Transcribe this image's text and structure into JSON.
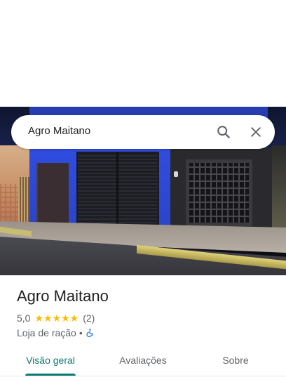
{
  "search": {
    "query": "Agro Maitano",
    "search_icon": "search-icon",
    "close_icon": "close-icon"
  },
  "place": {
    "name": "Agro Maitano",
    "rating": "5,0",
    "stars": "★★★★★",
    "star_count": 5,
    "review_count": "(2)",
    "category": "Loja de ração",
    "separator": "•",
    "accessibility_icon": "wheelchair-icon"
  },
  "tabs": [
    {
      "label": "Visão geral",
      "active": true
    },
    {
      "label": "Avaliações",
      "active": false
    },
    {
      "label": "Sobre",
      "active": false
    }
  ],
  "colors": {
    "accent": "#0b7a75",
    "star": "#fbbc04",
    "accessibility": "#1a73e8",
    "text_primary": "#202124",
    "text_secondary": "#5f6368"
  }
}
